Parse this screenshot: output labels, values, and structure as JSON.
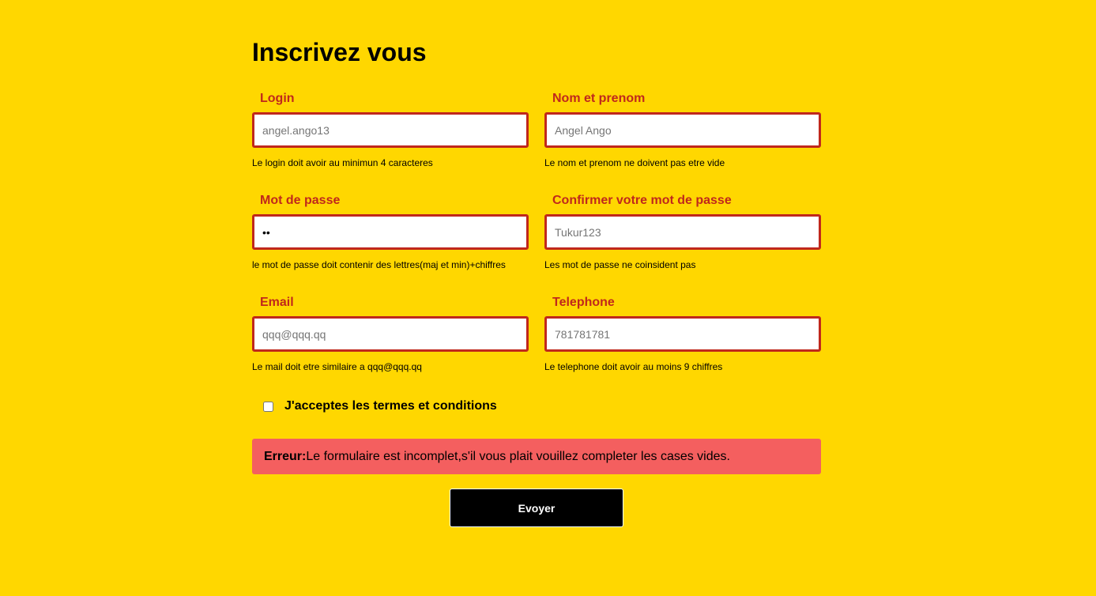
{
  "form": {
    "title": "Inscrivez vous",
    "fields": {
      "login": {
        "label": "Login",
        "placeholder": "angel.ango13",
        "value": "",
        "help": "Le login doit avoir au minimun 4 caracteres"
      },
      "name": {
        "label": "Nom et prenom",
        "placeholder": "Angel Ango",
        "value": "",
        "help": "Le nom et prenom ne doivent pas etre vide"
      },
      "password": {
        "label": "Mot de passe",
        "placeholder": "",
        "value": "ab",
        "help": "le mot de passe doit contenir des lettres(maj et min)+chiffres"
      },
      "confirm_password": {
        "label": "Confirmer votre mot de passe",
        "placeholder": "Tukur123",
        "value": "",
        "help": "Les mot de passe ne coinsident pas"
      },
      "email": {
        "label": "Email",
        "placeholder": "qqq@qqq.qq",
        "value": "",
        "help": "Le mail doit etre similaire a qqq@qqq.qq"
      },
      "telephone": {
        "label": "Telephone",
        "placeholder": "781781781",
        "value": "",
        "help": "Le telephone doit avoir au moins 9 chiffres"
      }
    },
    "terms": {
      "label": "J'acceptes les termes et conditions",
      "checked": false
    },
    "error": {
      "prefix": "Erreur:",
      "message": "Le formulaire est incomplet,s'il vous plait vouillez completer les cases vides."
    },
    "submit_label": "Evoyer"
  },
  "colors": {
    "background": "#FFD700",
    "label": "#C0281C",
    "input_border": "#C0281C",
    "error_background": "#F45F5F",
    "button_background": "#000000"
  }
}
